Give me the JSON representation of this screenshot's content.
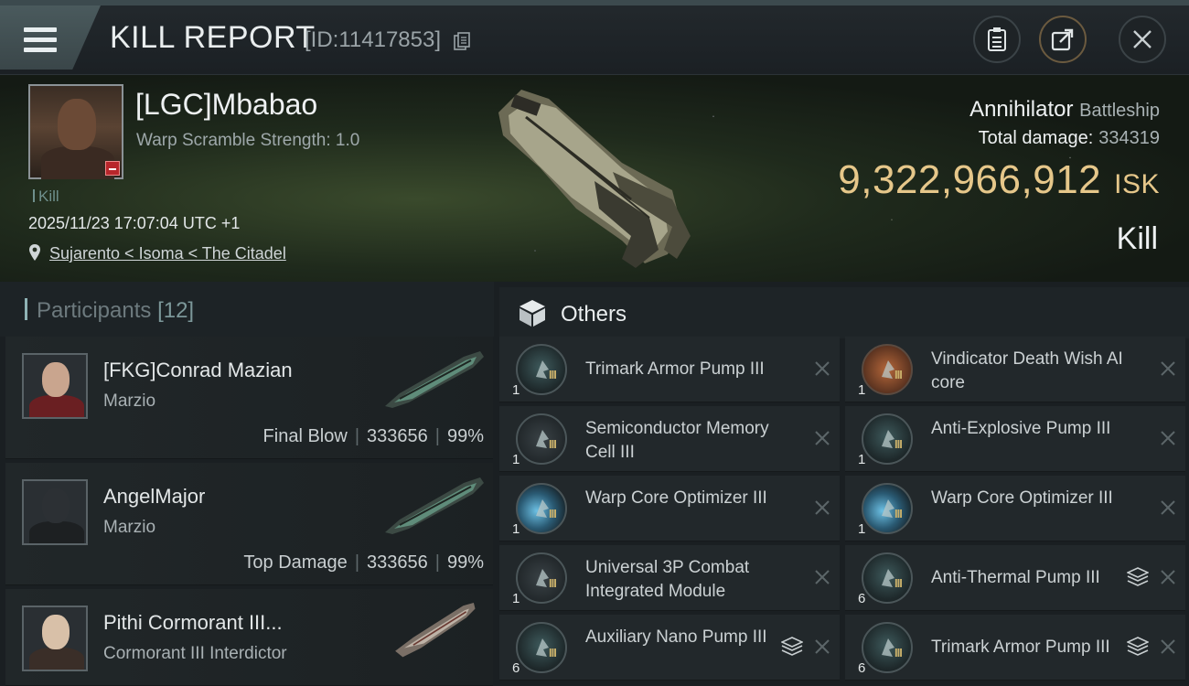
{
  "header": {
    "title": "KILL REPORT",
    "report_id": "[ID:11417853]"
  },
  "victim": {
    "name": "[LGC]Mbabao",
    "warp_scramble": "Warp Scramble Strength: 1.0",
    "tag": "Kill",
    "datetime": "2025/11/23 17:07:04 UTC +1",
    "location": "Sujarento < Isoma < The Citadel",
    "ship_name": "Annihilator",
    "ship_class": "Battleship",
    "total_damage_label": "Total damage:",
    "total_damage": "334319",
    "isk_value": "9,322,966,912",
    "isk_unit": "ISK",
    "result": "Kill"
  },
  "participants": {
    "label": "Participants",
    "count": "[12]",
    "items": [
      {
        "name": "[FKG]Conrad Mazian",
        "corp": "Marzio",
        "role": "Final Blow",
        "damage": "333656",
        "percent": "99%"
      },
      {
        "name": "AngelMajor",
        "corp": "Marzio",
        "role": "Top Damage",
        "damage": "333656",
        "percent": "99%"
      },
      {
        "name": "Pithi Cormorant III...",
        "corp": "Cormorant III Interdictor",
        "role": "",
        "damage": "",
        "percent": ""
      }
    ]
  },
  "others": {
    "title": "Others",
    "items": [
      {
        "name": "Trimark Armor Pump III",
        "qty": "1",
        "icon": "pump-icon",
        "stacked": false
      },
      {
        "name": "Vindicator Death Wish AI core",
        "qty": "1",
        "icon": "ai-core-icon",
        "stacked": false
      },
      {
        "name": "Semiconductor Memory Cell III",
        "qty": "1",
        "icon": "memory-cell-icon",
        "stacked": false
      },
      {
        "name": "Anti-Explosive Pump III",
        "qty": "1",
        "icon": "pump-icon",
        "stacked": false
      },
      {
        "name": "Warp Core Optimizer III",
        "qty": "1",
        "icon": "optimizer-icon",
        "stacked": false
      },
      {
        "name": "Warp Core Optimizer III",
        "qty": "1",
        "icon": "optimizer-icon",
        "stacked": false
      },
      {
        "name": "Universal 3P Combat Integrated Module",
        "qty": "1",
        "icon": "combat-module-icon",
        "stacked": false
      },
      {
        "name": "Anti-Thermal Pump III",
        "qty": "6",
        "icon": "pump-icon",
        "stacked": true
      },
      {
        "name": "Auxiliary Nano Pump III",
        "qty": "6",
        "icon": "pump-icon",
        "stacked": true
      },
      {
        "name": "Trimark Armor Pump III",
        "qty": "6",
        "icon": "pump-icon",
        "stacked": true
      }
    ]
  },
  "colors": {
    "isk": "#e6c78a",
    "accent": "#8fb3b5",
    "tier": "#c9b06a"
  }
}
